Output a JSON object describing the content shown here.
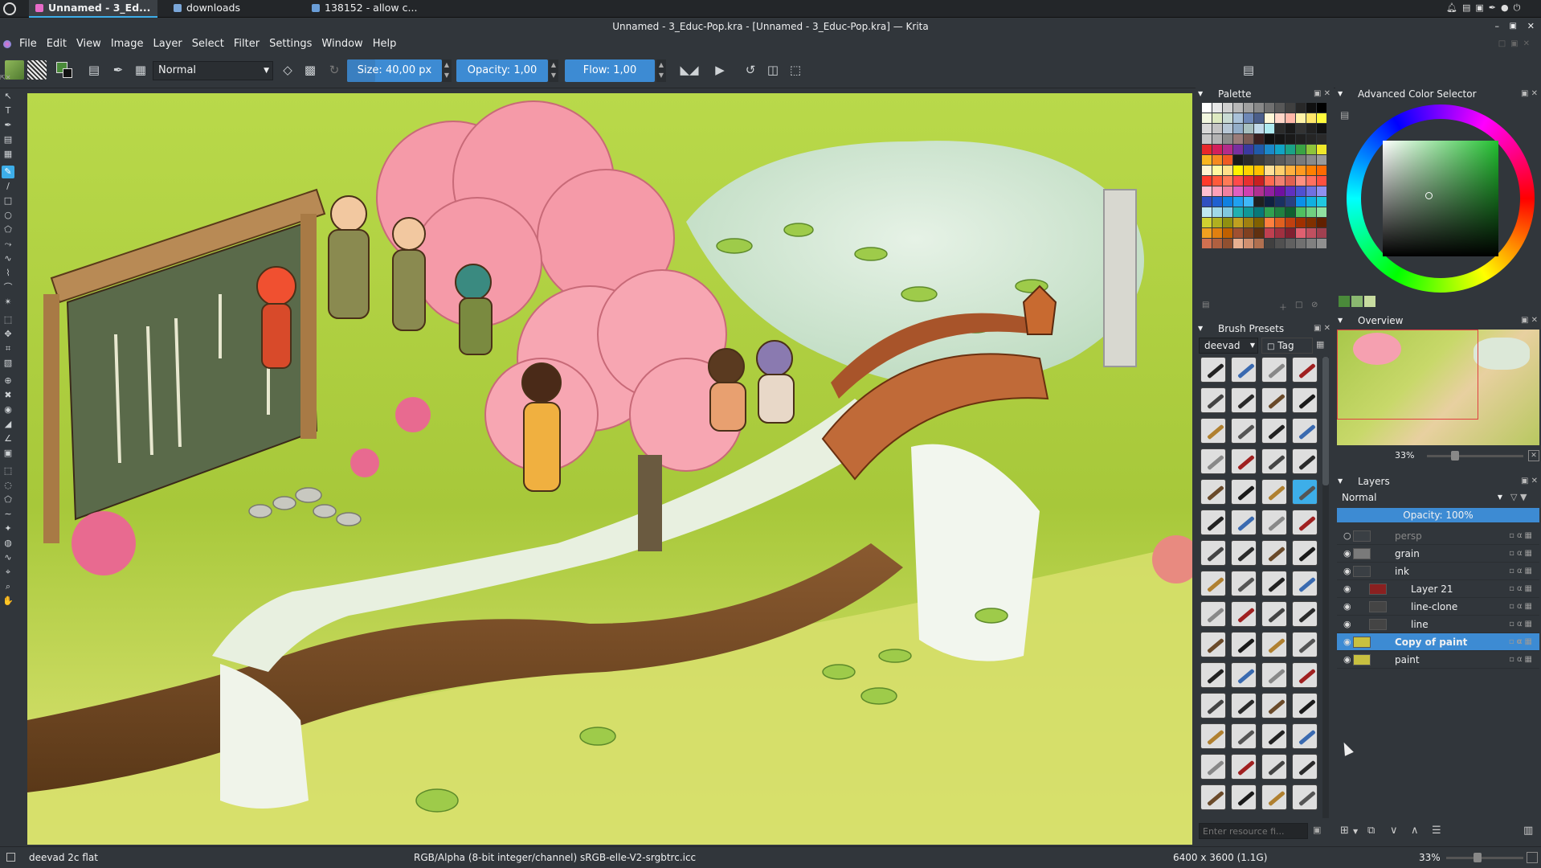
{
  "taskbar": {
    "tasks": [
      {
        "label": "Unnamed - 3_Ed...",
        "icon": "krita-icon"
      },
      {
        "label": "downloads",
        "icon": "folder-icon"
      },
      {
        "label": "138152 - allow c...",
        "icon": "browser-icon"
      }
    ]
  },
  "window": {
    "title": "Unnamed - 3_Educ-Pop.kra  - [Unnamed - 3_Educ-Pop.kra] — Krita"
  },
  "menu": {
    "items": [
      "File",
      "Edit",
      "View",
      "Image",
      "Layer",
      "Select",
      "Filter",
      "Settings",
      "Window",
      "Help"
    ]
  },
  "toolbar": {
    "blend_mode": "Normal",
    "size_label": "Size:",
    "size_value": "40,00 px",
    "opacity_label": "Opacity:",
    "opacity_value": "1,00",
    "flow_label": "Flow:",
    "flow_value": "1,00"
  },
  "palette": {
    "title": "Palette",
    "colors": [
      "#ffffff",
      "#e8e8e8",
      "#d0d0d0",
      "#b8b8b8",
      "#a0a0a0",
      "#888888",
      "#707070",
      "#585858",
      "#404040",
      "#282828",
      "#101010",
      "#000000",
      "#f2f7e0",
      "#dde9c0",
      "#c9dbd3",
      "#a9c1d8",
      "#6e88b7",
      "#4b5e8a",
      "#fff8d8",
      "#ffd6c8",
      "#ffb7a8",
      "#fff2a8",
      "#ffe66b",
      "#fffb3c",
      "#d8d8d8",
      "#c4c4c4",
      "#b7c7d6",
      "#93adc8",
      "#a8c0c0",
      "#c0d8e8",
      "#aeeaf0",
      "#2b2b2b",
      "#1a1a1a",
      "#333333",
      "#222222",
      "#111111",
      "#c7c7c7",
      "#b3b3b3",
      "#8c8c8c",
      "#9a7c7a",
      "#7a5a55",
      "#3a2020",
      "#101010",
      "#151515",
      "#1a1a1a",
      "#202020",
      "#252525",
      "#2a2a2a",
      "#e8282a",
      "#d31f5b",
      "#b42b8a",
      "#7a2fa0",
      "#3b3a9e",
      "#205aa8",
      "#1b88c8",
      "#11a3c5",
      "#1aa287",
      "#3aa344",
      "#8ec43b",
      "#f0e82a",
      "#f8b51e",
      "#f58a1f",
      "#ef5a23",
      "#1a1a1a",
      "#2a2a2a",
      "#3a3a3a",
      "#4a4a4a",
      "#5a5a5a",
      "#6a6a6a",
      "#7a7a7a",
      "#8a8a8a",
      "#9a9a9a",
      "#fff3d0",
      "#fff7a0",
      "#ffe08a",
      "#fff200",
      "#ffd200",
      "#ffc000",
      "#ffe09a",
      "#ffcf6e",
      "#ffb040",
      "#ff9a20",
      "#ff8000",
      "#ff6a00",
      "#ff3a2a",
      "#ff5a3a",
      "#ff7a55",
      "#ff4a4a",
      "#e83030",
      "#c82020",
      "#ff6a50",
      "#f08070",
      "#e06050",
      "#ff9080",
      "#ff7060",
      "#ff5040",
      "#ffc0d0",
      "#ffa0b8",
      "#f080a0",
      "#e060c0",
      "#d040b0",
      "#b03090",
      "#9020a0",
      "#7010a0",
      "#6030c0",
      "#5050d0",
      "#7070e0",
      "#9090f0",
      "#3050c0",
      "#2060d0",
      "#1080e0",
      "#20a0f0",
      "#40b8f8",
      "#202020",
      "#102040",
      "#1a3060",
      "#2a4080",
      "#0a90e8",
      "#10b0e0",
      "#20c8e0",
      "#c0e8f0",
      "#a0d8e8",
      "#80c8e0",
      "#20b0b0",
      "#109898",
      "#087878",
      "#30a050",
      "#208040",
      "#106030",
      "#50c060",
      "#70d080",
      "#90e0a0",
      "#d0d030",
      "#b0b020",
      "#909010",
      "#c0a020",
      "#a08010",
      "#806000",
      "#ff8040",
      "#e06020",
      "#c04010",
      "#a03000",
      "#803000",
      "#602000",
      "#f0a020",
      "#e08010",
      "#c06000",
      "#a05030",
      "#804020",
      "#603010",
      "#c04050",
      "#a03040",
      "#802030",
      "#e06070",
      "#c05060",
      "#a04050",
      "#d07050",
      "#b06040",
      "#905030",
      "#e8b090",
      "#d09070",
      "#b07050",
      "#404040",
      "#505050",
      "#606060",
      "#707070",
      "#808080",
      "#909090"
    ]
  },
  "color_selector": {
    "title": "Advanced Color Selector"
  },
  "overview": {
    "title": "Overview",
    "zoom": "33%"
  },
  "brush_presets": {
    "title": "Brush Presets",
    "tag_filter": "deevad",
    "tag_button": "Tag",
    "search_placeholder": "Enter resource fi..."
  },
  "layers": {
    "title": "Layers",
    "blend_mode": "Normal",
    "opacity_label": "Opacity:  100%",
    "items": [
      {
        "name": "persp",
        "indent": 0,
        "visible": false,
        "selected": false,
        "thumb": "#3a3f44"
      },
      {
        "name": "grain",
        "indent": 0,
        "visible": true,
        "selected": false,
        "thumb": "#7a7a7a"
      },
      {
        "name": "ink",
        "indent": 0,
        "visible": true,
        "selected": false,
        "thumb": "#3a3f44"
      },
      {
        "name": "Layer 21",
        "indent": 1,
        "visible": true,
        "selected": false,
        "thumb": "#8a2020"
      },
      {
        "name": "line-clone",
        "indent": 1,
        "visible": true,
        "selected": false,
        "thumb": "#444"
      },
      {
        "name": "line",
        "indent": 1,
        "visible": true,
        "selected": false,
        "thumb": "#444"
      },
      {
        "name": "Copy of paint",
        "indent": 0,
        "visible": true,
        "selected": true,
        "thumb": "#c8c040"
      },
      {
        "name": "paint",
        "indent": 0,
        "visible": true,
        "selected": false,
        "thumb": "#c8c040"
      }
    ]
  },
  "status": {
    "brush_name": "deevad 2c flat",
    "color_model": "RGB/Alpha (8-bit integer/channel)  sRGB-elle-V2-srgbtrc.icc",
    "image_size": "6400 x 3600 (1.1G)",
    "zoom": "33%"
  }
}
